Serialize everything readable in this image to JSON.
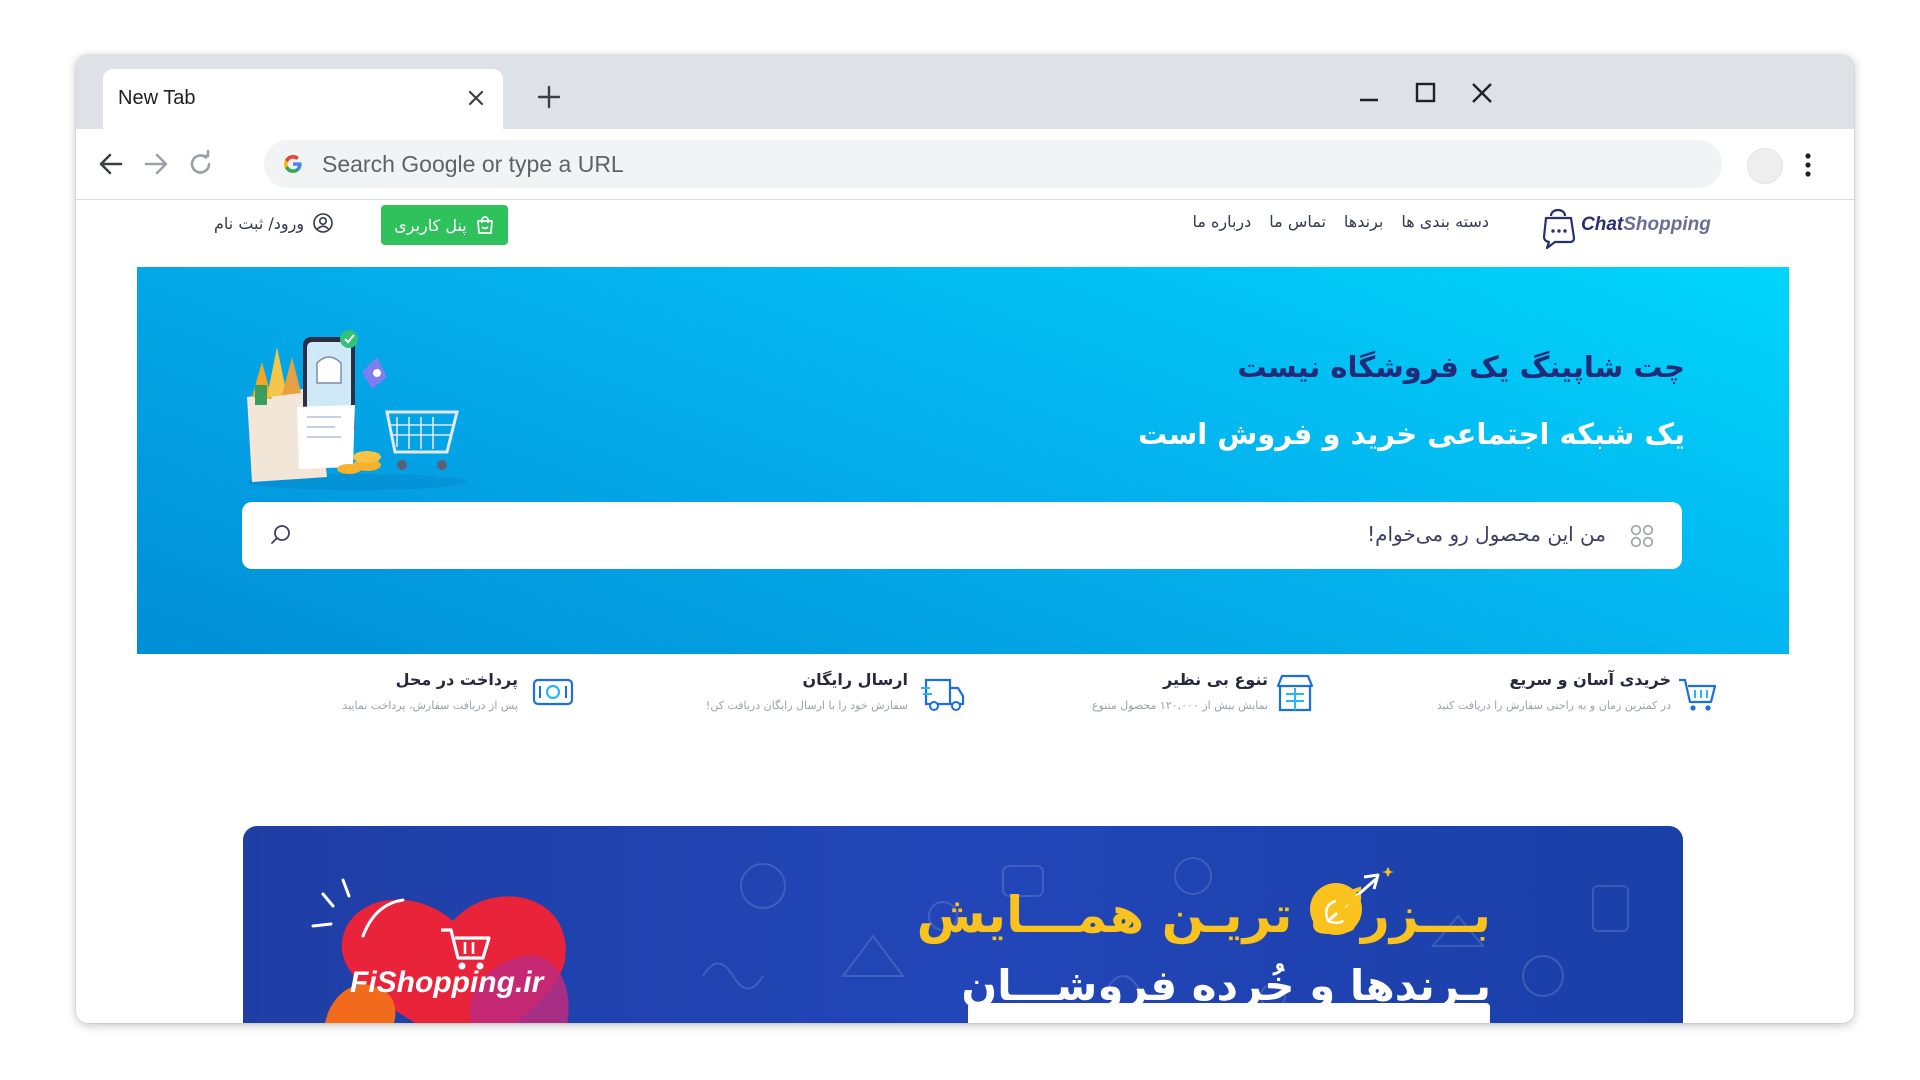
{
  "browser": {
    "tab_title": "New Tab",
    "omnibox_placeholder": "Search Google or type a URL"
  },
  "site": {
    "logo_part1": "Chat",
    "logo_part2": "Shopping",
    "nav": [
      "دسته بندی ها",
      "برندها",
      "تماس ما",
      "درباره ما"
    ],
    "panel_button": "پنل کاربری",
    "login_link": "ورود/ ثبت نام"
  },
  "hero": {
    "line1": "چت شاپینگ یک فروشگاه نیست",
    "line2": "یک شبکه اجتماعی خرید و فروش است",
    "search_placeholder": "من این محصول رو می‌خوام!"
  },
  "features": [
    {
      "title": "خریدی آسان و سریع",
      "subtitle": "در کمترین زمان و به راحتی سفارش را دریافت کنید",
      "icon": "cart-icon"
    },
    {
      "title": "تنوع بی نظیر",
      "subtitle": "نمایش بیش از ۱۲۰,۰۰۰ محصول متنوع",
      "icon": "store-icon"
    },
    {
      "title": "ارسال رایگان",
      "subtitle": "سفارش خود را با ارسال رایگان دریافت کن!",
      "icon": "delivery-truck-icon"
    },
    {
      "title": "پرداخت در محل",
      "subtitle": "پس از دریافت سفارش، پرداخت نمایید",
      "icon": "cash-icon"
    }
  ],
  "banner": {
    "headline": "بـــزرگ تریـن همـــایش",
    "subheadline": "بـرندها و خُرده فروشـــان",
    "brand": "FiShopping.ir"
  },
  "colors": {
    "hero_navy": "#232a78",
    "panel_green": "#2ec15c",
    "banner_blue": "#2246b8",
    "banner_yellow": "#f9c21d"
  }
}
